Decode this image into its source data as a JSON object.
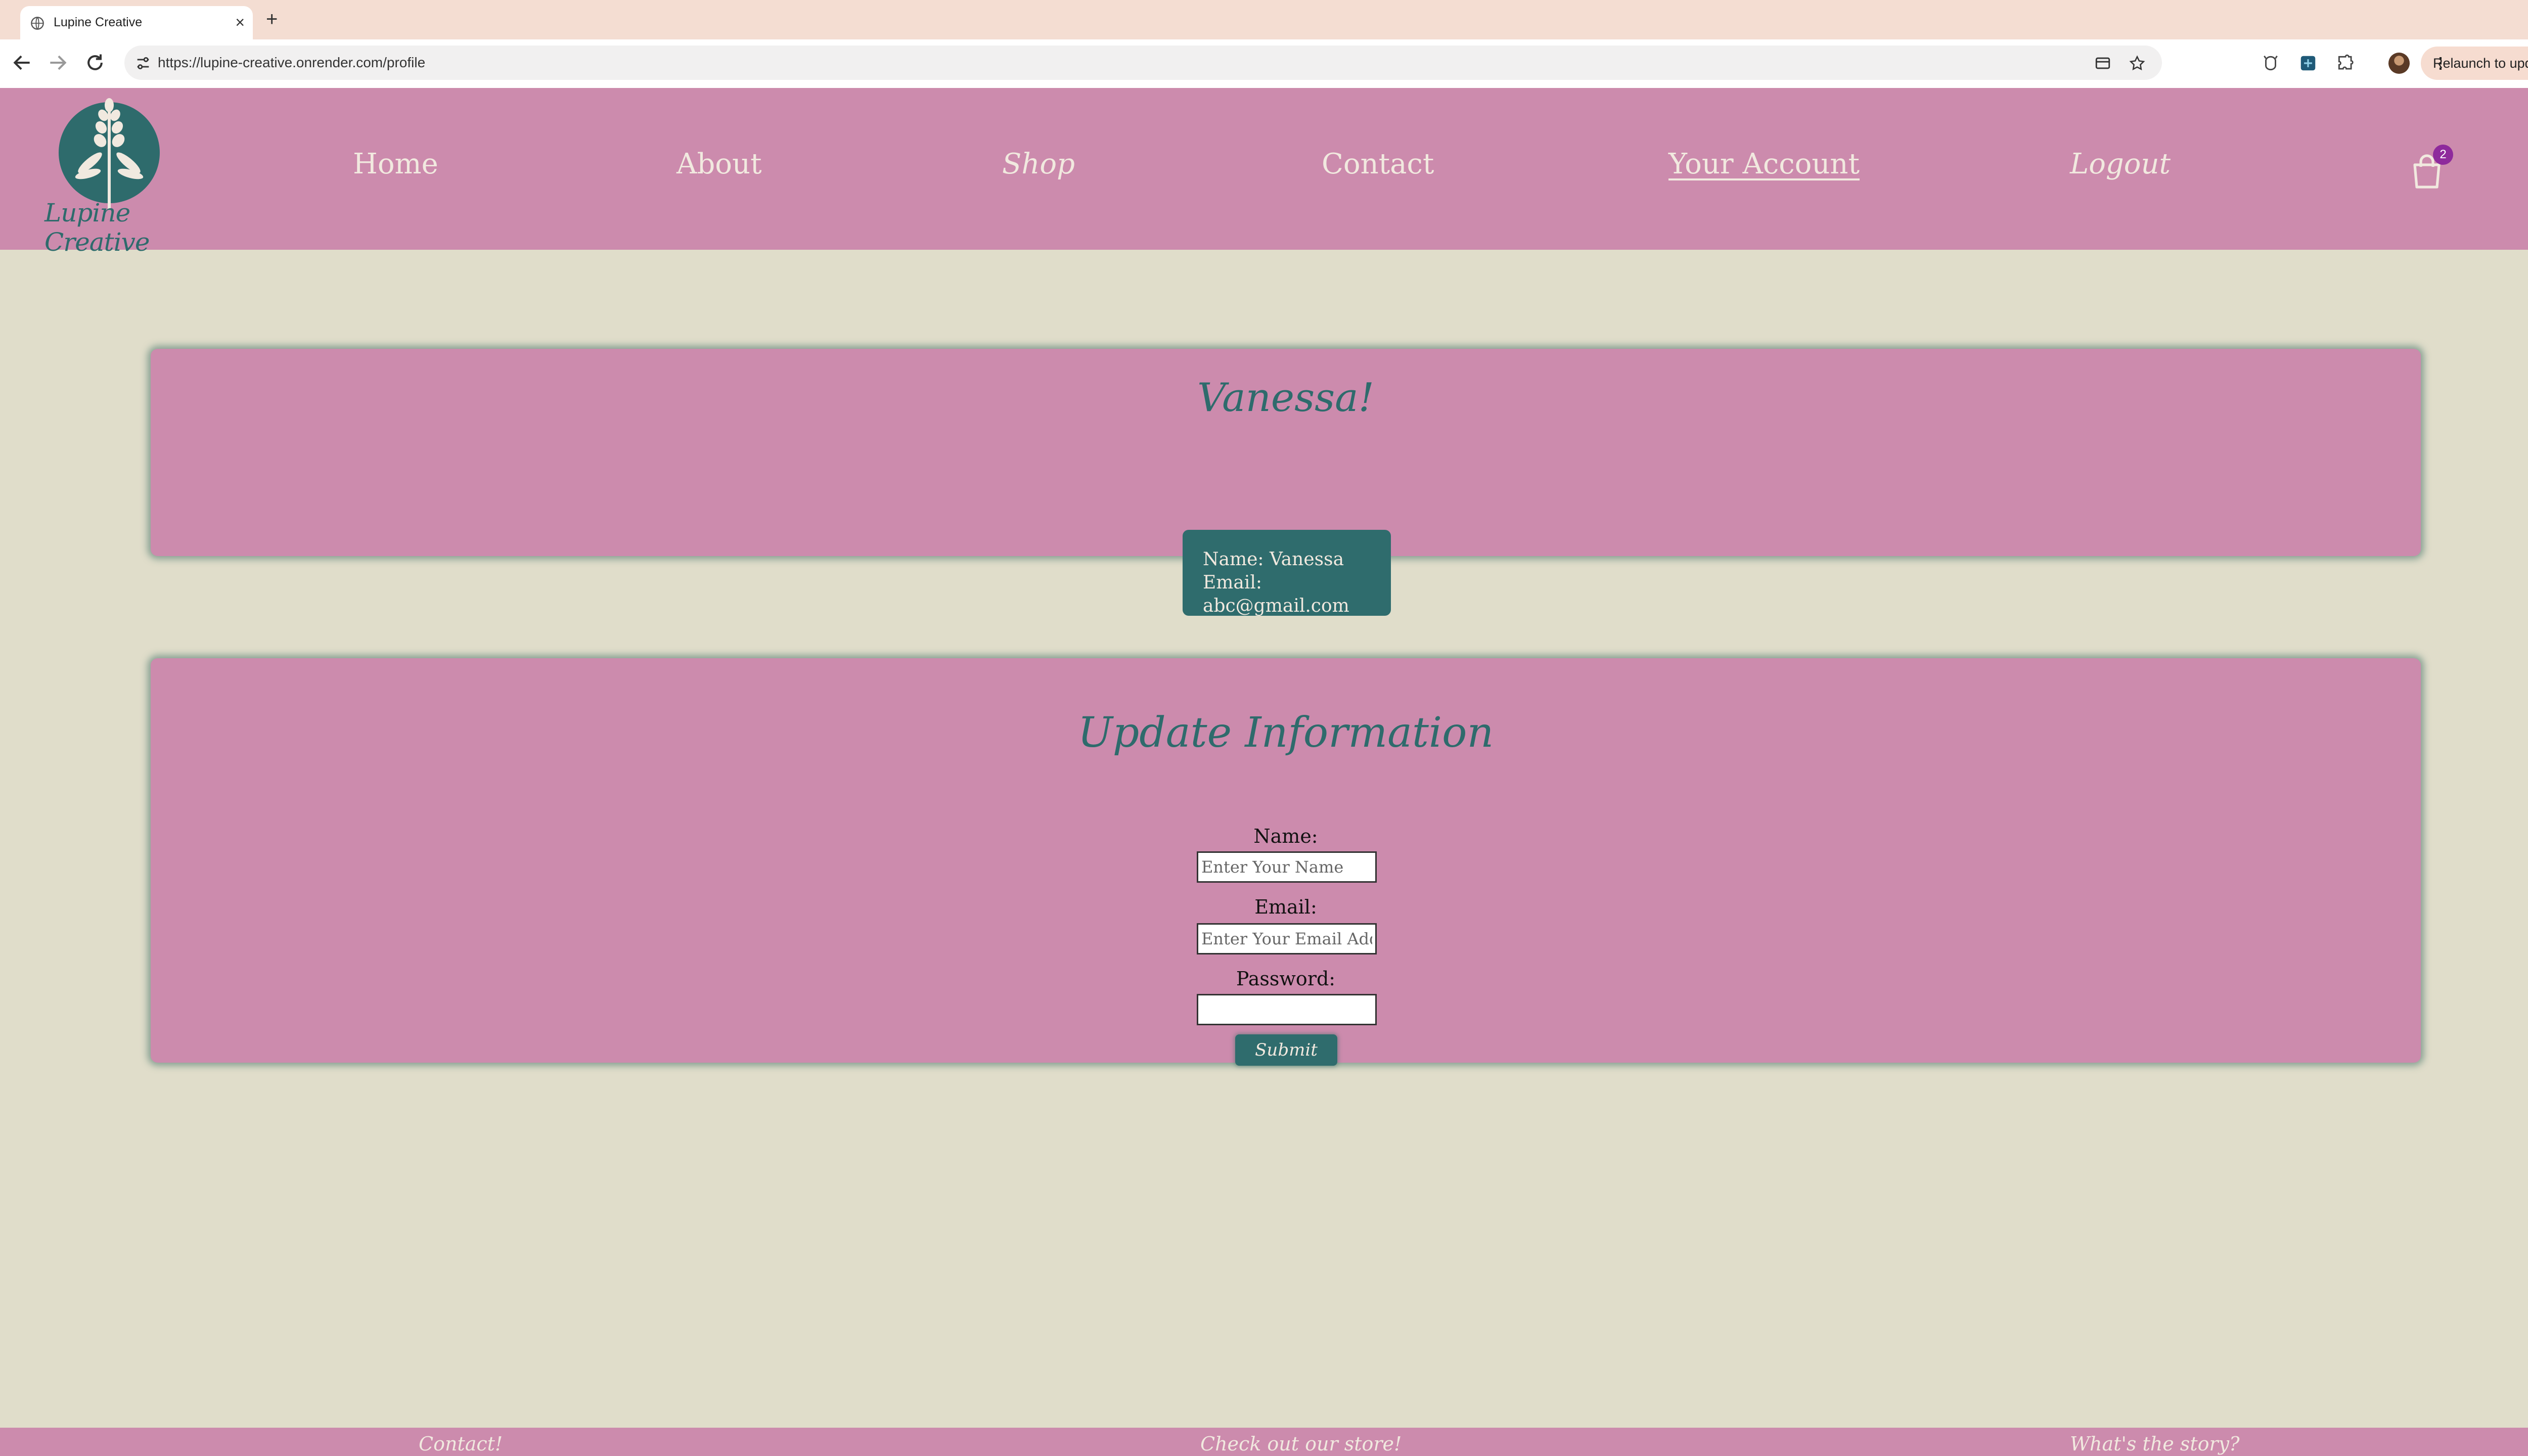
{
  "browser": {
    "tab_title": "Lupine Creative",
    "new_tab_symbol": "+",
    "close_symbol": "×",
    "url": "https://lupine-creative.onrender.com/profile",
    "relaunch_label": "Relaunch to update",
    "icons": [
      "globe-icon",
      "back-icon",
      "forward-icon",
      "reload-icon",
      "site-info-icon",
      "card-icon",
      "bookmark-star-icon",
      "extension-icon",
      "puzzle-icon",
      "profile-avatar"
    ]
  },
  "site": {
    "logo_text": "Lupine Creative",
    "nav": [
      {
        "label": "Home"
      },
      {
        "label": "About"
      },
      {
        "label": "Shop"
      },
      {
        "label": "Contact"
      },
      {
        "label": "Your Account"
      },
      {
        "label": "Logout"
      }
    ],
    "cart_count": "2",
    "colors": {
      "header": "#cc8bad",
      "accent": "#2f6c6d",
      "background": "#e0ddca",
      "nav_text": "#f1e9df"
    }
  },
  "profile": {
    "greeting": "Vanessa!",
    "name_line": "Name: Vanessa",
    "email_line": "Email: abc@gmail.com"
  },
  "update_form": {
    "title": "Update Information",
    "name_label": "Name:",
    "name_placeholder": "Enter Your Name",
    "email_label": "Email:",
    "email_placeholder": "Enter Your Email Address",
    "password_label": "Password:",
    "submit_label": "Submit"
  },
  "footer": {
    "links": [
      {
        "label": "Contact!"
      },
      {
        "label": "Check out our store!"
      },
      {
        "label": "What's the story?"
      }
    ]
  }
}
